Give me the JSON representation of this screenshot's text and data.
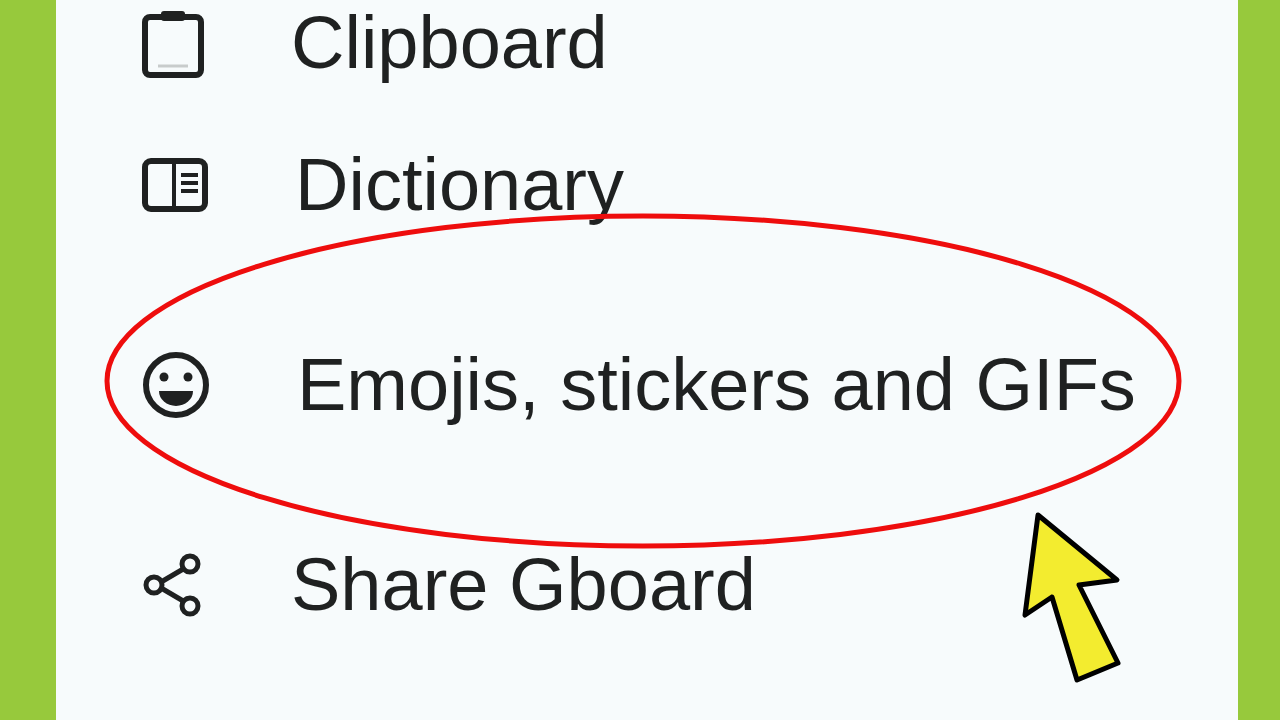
{
  "menu": {
    "items": [
      {
        "label": "Clipboard",
        "circled": false
      },
      {
        "label": "Dictionary",
        "circled": false
      },
      {
        "label": "Emojis, stickers and GIFs",
        "circled": true
      },
      {
        "label": "Share Gboard",
        "circled": false
      }
    ]
  }
}
